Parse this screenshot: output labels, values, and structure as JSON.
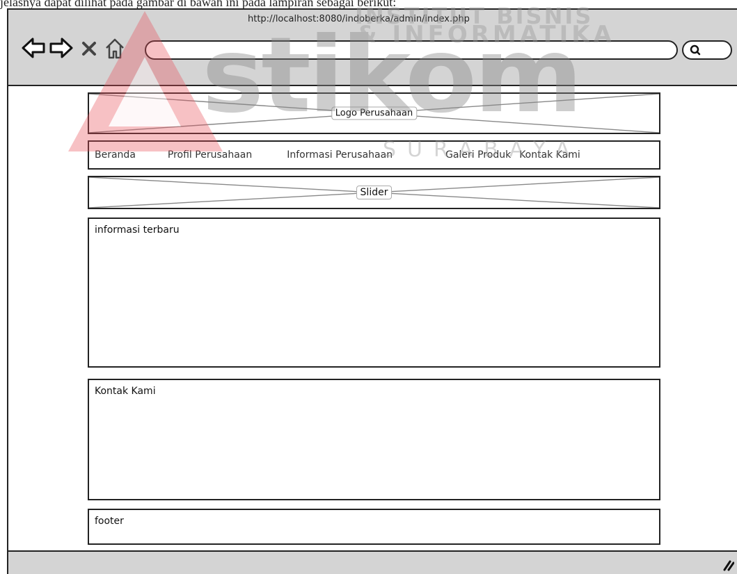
{
  "document": {
    "top_line": "jelasnya dapat dilihat pada gambar di bawah ini pada lampiran sebagai berikut:"
  },
  "browser": {
    "url": "http://localhost:8080/indoberka/admin/index.php"
  },
  "page": {
    "logo_label": "Logo Perusahaan",
    "nav_items": [
      "Beranda",
      "Profil Perusahaan",
      "Informasi Perusahaan",
      "Galeri Produk",
      "Kontak Kami"
    ],
    "slider_label": "Slider",
    "latest_info_title": "informasi terbaru",
    "contact_title": "Kontak Kami",
    "footer_label": "footer"
  },
  "watermark": {
    "brand": "stikom",
    "line_top": "INSTITUT BISNIS",
    "line_mid": "& INFORMATIKA",
    "line_bottom": "SURABAYA"
  },
  "colors": {
    "toolbar": "#d4d4d4",
    "border": "#222222",
    "watermark_red": "#e8505b"
  },
  "icons": [
    "back-arrow-icon",
    "forward-arrow-icon",
    "close-icon",
    "home-icon",
    "search-icon",
    "resize-grip-icon"
  ]
}
